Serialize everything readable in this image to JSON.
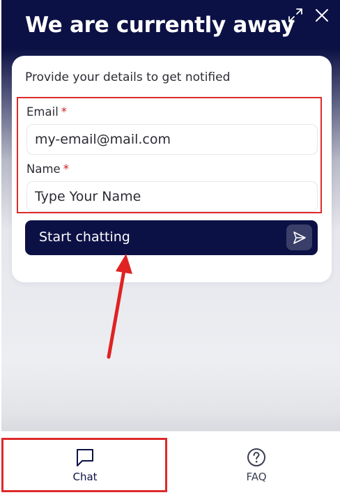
{
  "header": {
    "title": "We are currently away",
    "expand_icon": "expand-icon",
    "close_icon": "close-icon"
  },
  "form": {
    "intro": "Provide your details to get notified",
    "email": {
      "label": "Email",
      "required_mark": "*",
      "value": "my-email@mail.com"
    },
    "name": {
      "label": "Name",
      "required_mark": "*",
      "placeholder": "Type Your Name"
    },
    "submit": {
      "label": "Start chatting",
      "icon": "send-icon"
    }
  },
  "tabs": [
    {
      "label": "Chat",
      "icon": "chat-bubble-icon",
      "selected": true
    },
    {
      "label": "FAQ",
      "icon": "question-circle-icon",
      "selected": false
    }
  ],
  "colors": {
    "brand_navy": "#0c1145",
    "annotation_red": "#dd2a2a",
    "required_red": "#d11f1f"
  }
}
